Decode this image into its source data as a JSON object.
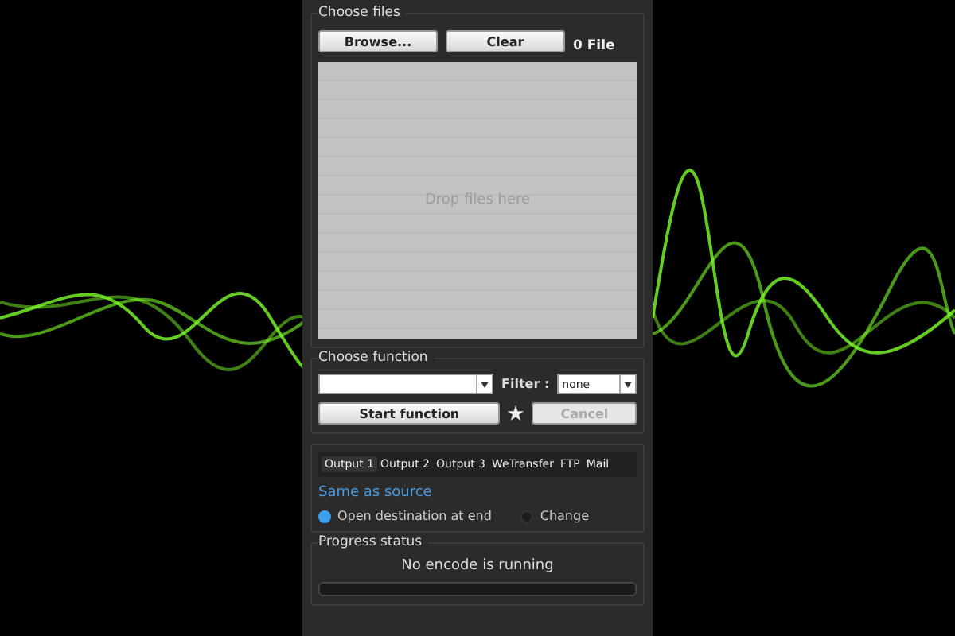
{
  "files": {
    "title": "Choose files",
    "buttons": [
      "Browse...",
      "Clear"
    ],
    "count": "0 File",
    "drop_hint": "Drop files here"
  },
  "function": {
    "title": "Choose function",
    "filter_label": "Filter :",
    "filter_select": {
      "value": "none"
    },
    "start": {
      "label": "Start function",
      "disabled": false
    },
    "cancel": {
      "label": "Cancel",
      "disabled": true
    }
  },
  "outputs": {
    "tabs": [
      {
        "label": "Output 1",
        "selected": true
      },
      {
        "label": "Output 2",
        "selected": false
      },
      {
        "label": "Output 3",
        "selected": false
      },
      {
        "label": "WeTransfer",
        "selected": false
      },
      {
        "label": "FTP",
        "selected": false
      },
      {
        "label": "Mail",
        "selected": false
      }
    ],
    "destination": "Same as source",
    "options": [
      {
        "label": "Open destination at end",
        "selected": true
      },
      {
        "label": "Change",
        "selected": false
      }
    ]
  },
  "progress": {
    "title": "Progress status",
    "message": "No encode is running",
    "level": 0
  }
}
